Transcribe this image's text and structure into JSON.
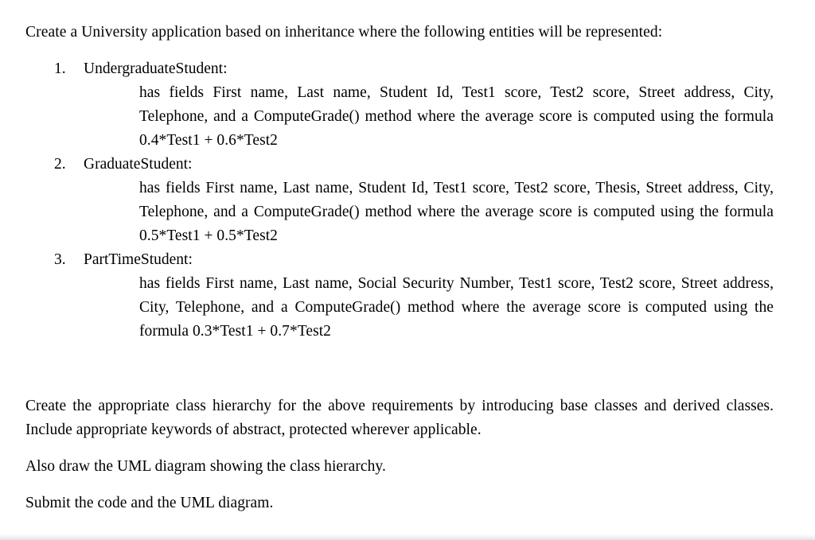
{
  "document": {
    "intro": "Create a University application based on inheritance where the following entities will be represented:",
    "entities": [
      {
        "number": "1.",
        "name": "UndergraduateStudent:",
        "description": "has fields First name, Last name, Student Id, Test1 score, Test2 score, Street address, City, Telephone, and a ComputeGrade() method where the average score is computed using the formula 0.4*Test1 + 0.6*Test2"
      },
      {
        "number": "2.",
        "name": "GraduateStudent:",
        "description": "has fields First name, Last name, Student Id, Test1 score, Test2 score, Thesis, Street address, City, Telephone, and a ComputeGrade() method where the average score is computed using the formula 0.5*Test1 + 0.5*Test2"
      },
      {
        "number": "3.",
        "name": "PartTimeStudent:",
        "description": "has fields First name, Last name, Social Security Number, Test1 score, Test2 score, Street address, City, Telephone, and a ComputeGrade() method where the average score is computed using the formula 0.3*Test1 + 0.7*Test2"
      }
    ],
    "closing": [
      "Create the appropriate class hierarchy for the above requirements by introducing base classes and derived classes. Include appropriate keywords of abstract, protected wherever applicable.",
      "Also draw the UML diagram showing the class hierarchy.",
      "Submit the code and the UML diagram."
    ]
  }
}
